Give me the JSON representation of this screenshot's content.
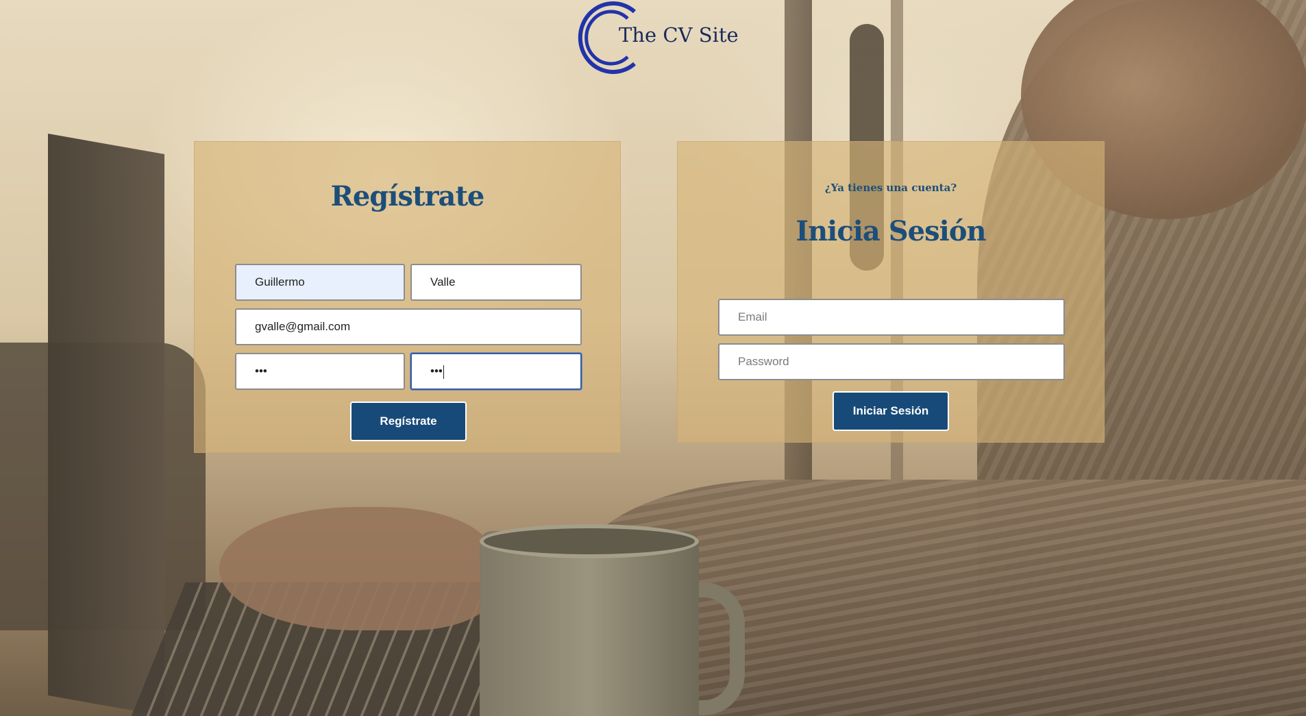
{
  "brand": {
    "logo_text": "The CV Site",
    "logo_color": "#2233aa"
  },
  "register": {
    "title": "Regístrate",
    "first_name_value": "Guillermo",
    "last_name_value": "Valle",
    "email_value": "gvalle@gmail.com",
    "password_value": "•••",
    "confirm_password_value": "•••",
    "submit_label": "Regístrate"
  },
  "login": {
    "subtitle": "¿Ya tienes una cuenta?",
    "title": "Inicia Sesión",
    "email_placeholder": "Email",
    "password_placeholder": "Password",
    "submit_label": "Iniciar Sesión"
  },
  "colors": {
    "accent": "#1d4e7a",
    "button": "#174a78",
    "panel": "#d7b478"
  }
}
